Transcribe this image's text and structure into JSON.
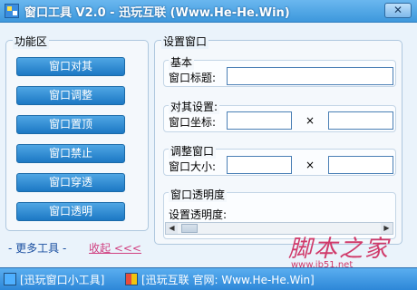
{
  "window": {
    "title": "窗口工具 V2.0 - 迅玩互联 (Www.He-He.Win)",
    "close_label": "✕"
  },
  "functions": {
    "group_title": "功能区",
    "buttons": [
      "窗口对其",
      "窗口调整",
      "窗口置顶",
      "窗口禁止",
      "窗口穿透",
      "窗口透明"
    ],
    "more_tools": "- 更多工具 -",
    "collapse": "收起 <<<"
  },
  "settings": {
    "group_title": "设置窗口",
    "basic": {
      "title": "基本",
      "label": "窗口标题:",
      "value": ""
    },
    "align": {
      "title": "对其设置:",
      "label": "窗口坐标:",
      "x_value": "",
      "y_value": "",
      "separator": "×"
    },
    "resize": {
      "title": "调整窗口",
      "label": "窗口大小:",
      "w_value": "",
      "h_value": "",
      "separator": "×"
    },
    "opacity": {
      "title": "窗口透明度",
      "label": "设置透明度:",
      "value_fraction": 0.02
    }
  },
  "watermark": {
    "text": "脚本之家",
    "url": "www.jb51.net"
  },
  "statusbar": {
    "left_text": "[迅玩窗口小工具]",
    "right_text": "[迅玩互联 官网: Www.He-He.Win]"
  },
  "colors": {
    "titlebar": "#3d98dc",
    "button_blue": "#1c78c4",
    "collapse_link": "#d04080",
    "watermark": "#d03a6a"
  }
}
